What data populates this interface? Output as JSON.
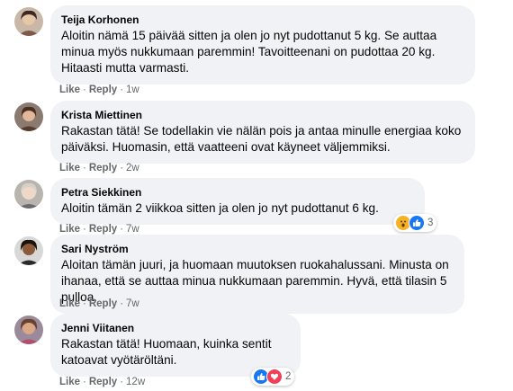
{
  "comments": [
    {
      "author": "Teija Korhonen",
      "text": "Aloitin nämä 15 päivää sitten ja olen jo nyt pudottanut 5 kg. Se auttaa minua myös nukkumaan paremmin! Tavoitteenani on pudottaa 20 kg. Hitaasti mutta varmasti.",
      "like": "Like",
      "reply": "Reply",
      "time": "1w"
    },
    {
      "author": "Krista Miettinen",
      "text": "Rakastan tätä! Se todellakin vie nälän pois ja antaa minulle energiaa koko päiväksi. Huomasin, että vaatteeni ovat käyneet väljemmiksi.",
      "like": "Like",
      "reply": "Reply",
      "time": "2w"
    },
    {
      "author": "Petra Siekkinen",
      "text": "Aloitin tämän 2 viikkoa sitten ja olen jo nyt pudottanut 6 kg.",
      "like": "Like",
      "reply": "Reply",
      "time": "7w",
      "reactions": {
        "icons": [
          "wow-icon",
          "like-icon"
        ],
        "count": "3"
      }
    },
    {
      "author": "Sari Nyström",
      "text": "Aloitan tämän juuri, ja huomaan muutoksen ruokahalussani. Minusta on ihanaa, että se auttaa minua nukkumaan paremmin. Hyvä, että tilasin 5 pulloa.",
      "like": "Like",
      "reply": "Reply",
      "time": "7w"
    },
    {
      "author": "Jenni Viitanen",
      "text": "Rakastan tätä! Huomaan, kuinka sentit katoavat vyötäröltäni.",
      "like": "Like",
      "reply": "Reply",
      "time": "12w",
      "reactions": {
        "icons": [
          "like-icon",
          "love-icon"
        ],
        "count": "2"
      }
    }
  ],
  "colors": {
    "bubble": "#f0f2f5",
    "meta": "#65676b",
    "like_blue": "#1877f2",
    "love_red": "#f33e58",
    "wow_yellow": "#f7b125"
  }
}
